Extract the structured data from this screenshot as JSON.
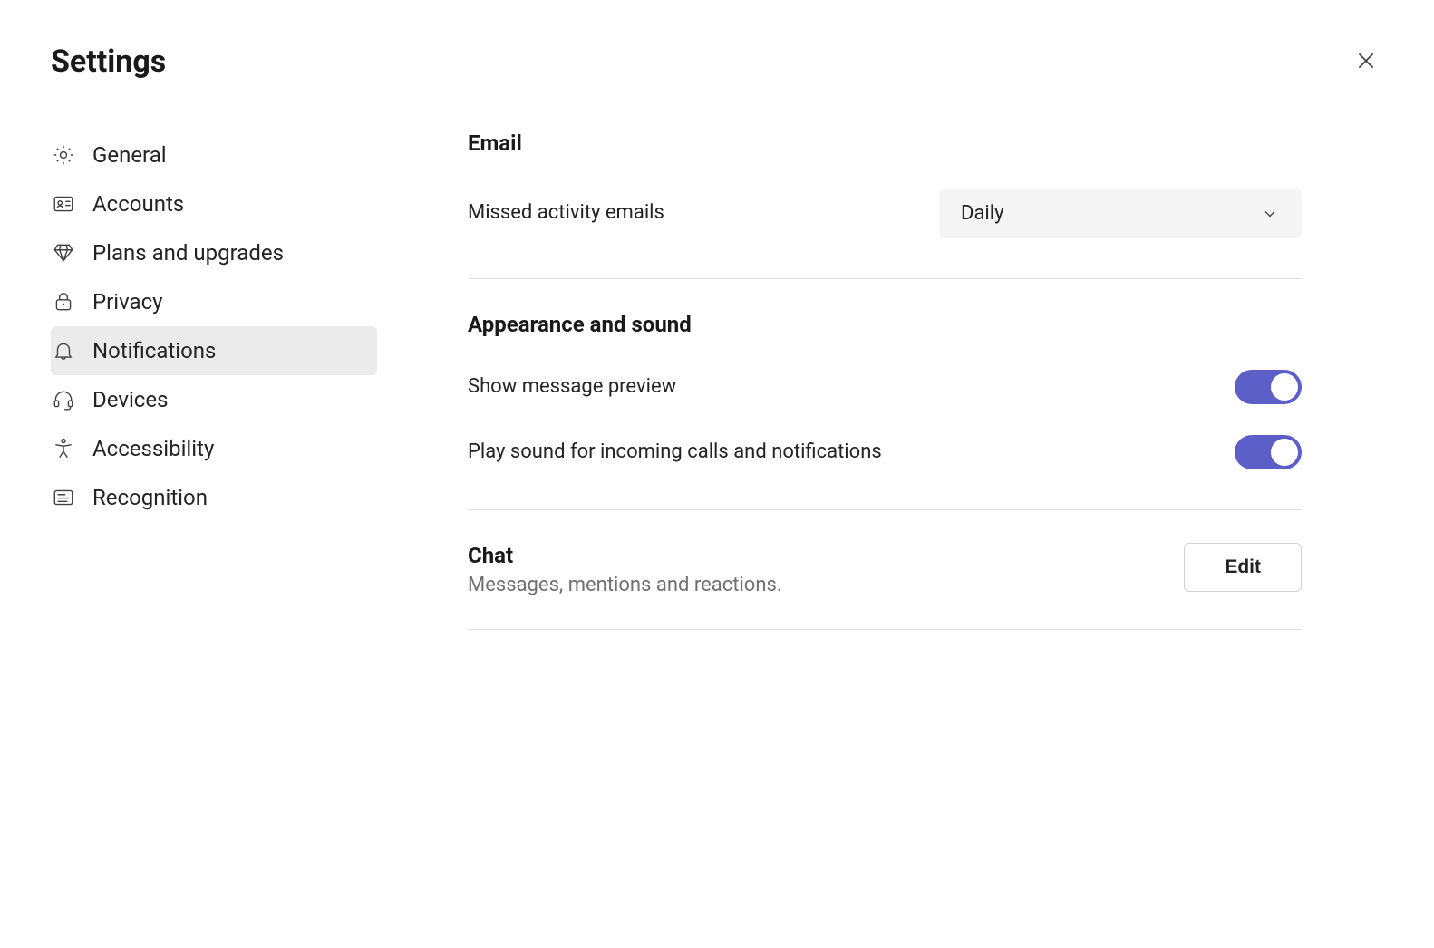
{
  "header": {
    "title": "Settings"
  },
  "sidebar": {
    "items": [
      {
        "id": "general",
        "label": "General",
        "icon": "gear-icon",
        "active": false
      },
      {
        "id": "accounts",
        "label": "Accounts",
        "icon": "id-card-icon",
        "active": false
      },
      {
        "id": "plans",
        "label": "Plans and upgrades",
        "icon": "diamond-icon",
        "active": false
      },
      {
        "id": "privacy",
        "label": "Privacy",
        "icon": "lock-icon",
        "active": false
      },
      {
        "id": "notifications",
        "label": "Notifications",
        "icon": "bell-icon",
        "active": true
      },
      {
        "id": "devices",
        "label": "Devices",
        "icon": "headset-icon",
        "active": false
      },
      {
        "id": "accessibility",
        "label": "Accessibility",
        "icon": "accessibility-icon",
        "active": false
      },
      {
        "id": "recognition",
        "label": "Recognition",
        "icon": "recognition-icon",
        "active": false
      }
    ]
  },
  "content": {
    "email": {
      "section_title": "Email",
      "missed_activity_label": "Missed activity emails",
      "missed_activity_value": "Daily"
    },
    "appearance": {
      "section_title": "Appearance and sound",
      "preview_label": "Show message preview",
      "preview_on": true,
      "sound_label": "Play sound for incoming calls and notifications",
      "sound_on": true
    },
    "chat": {
      "section_title": "Chat",
      "subtitle": "Messages, mentions and reactions.",
      "edit_label": "Edit"
    }
  },
  "colors": {
    "toggle_on": "#5b5fc7",
    "sidebar_active_bg": "#ebebeb"
  }
}
